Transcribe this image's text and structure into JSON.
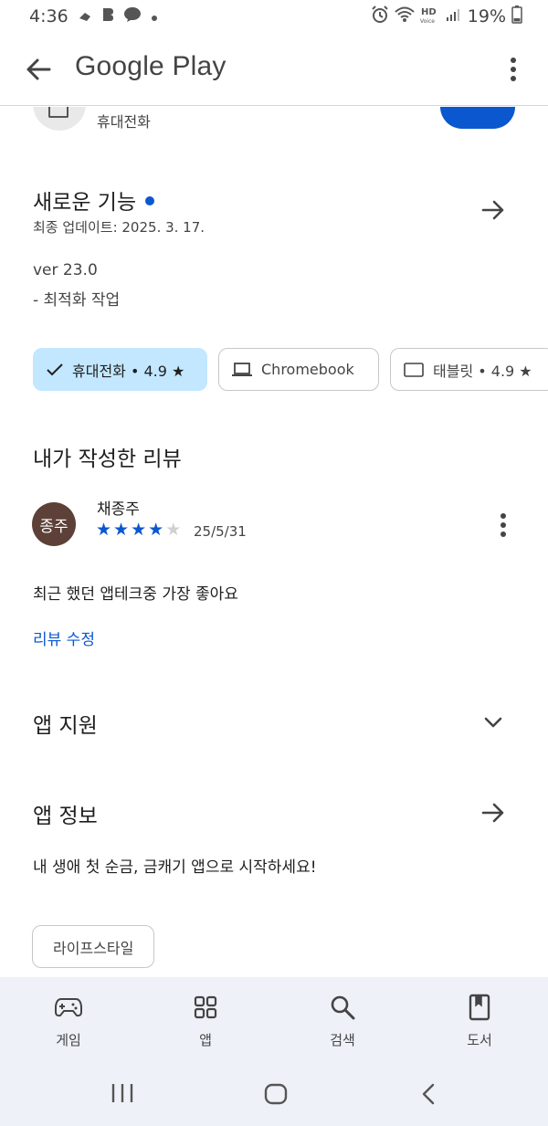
{
  "status_bar": {
    "time": "4:36",
    "battery": "19%"
  },
  "app_bar": {
    "title": "Google Play"
  },
  "peek": {
    "device_label": "휴대전화"
  },
  "whats_new": {
    "title": "새로운 기능",
    "last_updated": "최종 업데이트: 2025. 3. 17.",
    "version": "ver 23.0",
    "change": "- 최적화 작업"
  },
  "device_chips": [
    {
      "label": "휴대전화 • 4.9 ★",
      "selected": true
    },
    {
      "label": "Chromebook",
      "selected": false
    },
    {
      "label": "태블릿 • 4.9 ★",
      "selected": false
    }
  ],
  "my_review": {
    "title": "내가 작성한 리뷰",
    "avatar_text": "종주",
    "reviewer": "채종주",
    "rating": 4,
    "max_rating": 5,
    "date": "25/5/31",
    "text": "최근 했던 앱테크중 가장 좋아요",
    "edit_label": "리뷰 수정"
  },
  "app_support": {
    "title": "앱 지원"
  },
  "app_info": {
    "title": "앱 정보",
    "description": "내 생애 첫 순금, 금캐기 앱으로 시작하세요!",
    "category": "라이프스타일"
  },
  "bottom_nav": [
    {
      "label": "게임",
      "icon": "gamepad-icon"
    },
    {
      "label": "앱",
      "icon": "apps-grid-icon"
    },
    {
      "label": "검색",
      "icon": "search-icon"
    },
    {
      "label": "도서",
      "icon": "book-icon"
    }
  ],
  "colors": {
    "accent": "#0b57d0",
    "chip_selected": "#c2e7ff",
    "avatar": "#5d4037",
    "nav_bg": "#eef1f7"
  }
}
